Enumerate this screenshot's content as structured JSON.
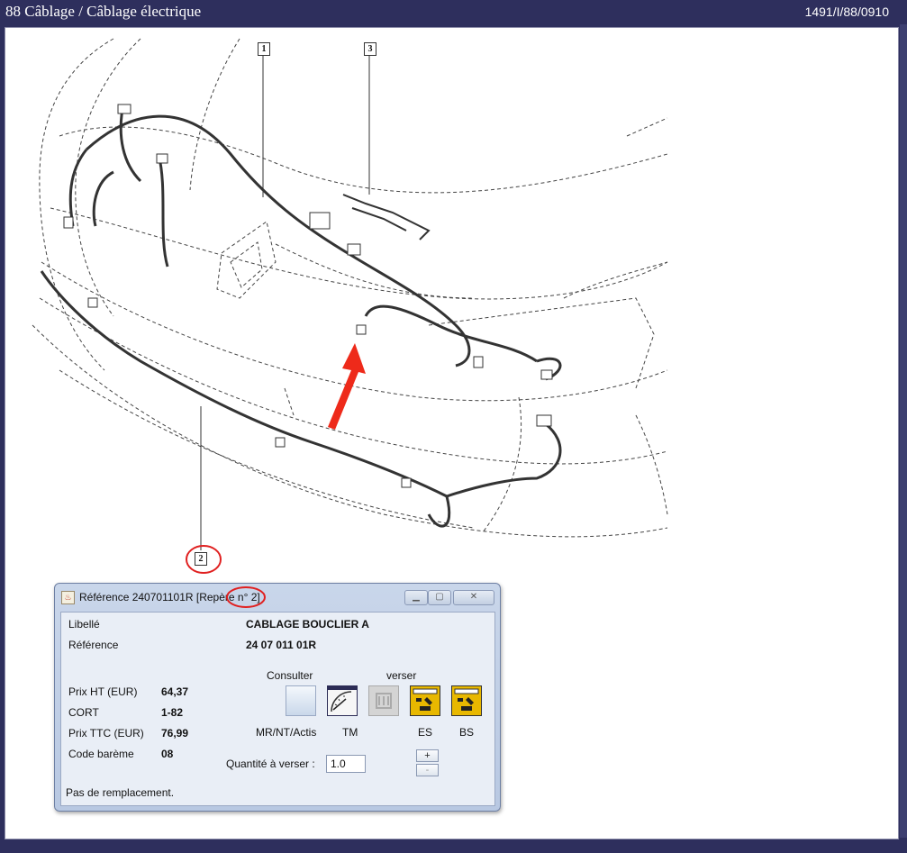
{
  "window": {
    "title": "88 Câblage / Câblage électrique",
    "code": "1491/I/88/0910"
  },
  "diagram": {
    "callouts": [
      "1",
      "2",
      "3"
    ]
  },
  "dialog": {
    "title": "Référence 240701101R [Repère n° 2]",
    "fields": {
      "libelle_label": "Libellé",
      "libelle_value": "CABLAGE BOUCLIER A",
      "reference_label": "Référence",
      "reference_value": "24 07 011 01R",
      "prix_ht_label": "Prix HT (EUR)",
      "prix_ht_value": "64,37",
      "cort_label": "CORT",
      "cort_value": "1-82",
      "prix_ttc_label": "Prix TTC (EUR)",
      "prix_ttc_value": "76,99",
      "code_bareme_label": "Code barème",
      "code_bareme_value": "08"
    },
    "consulter_label": "Consulter",
    "verser_label": "verser",
    "tools": [
      {
        "label": "MR/NT/Actis",
        "icon": "manual-icon",
        "enabled": true
      },
      {
        "label": "TM",
        "icon": "time-gauge-icon",
        "enabled": true
      },
      {
        "label": "",
        "icon": "part-disabled-icon",
        "enabled": false
      },
      {
        "label": "ES",
        "icon": "es-order-icon",
        "enabled": true
      },
      {
        "label": "BS",
        "icon": "bs-order-icon",
        "enabled": true
      }
    ],
    "quantity_label": "Quantité à verser :",
    "quantity_value": "1.0",
    "plus_label": "+",
    "minus_label": "-",
    "status_text": "Pas de remplacement."
  },
  "colors": {
    "window_bg": "#2e2f5d",
    "annotation": "#e02020"
  }
}
